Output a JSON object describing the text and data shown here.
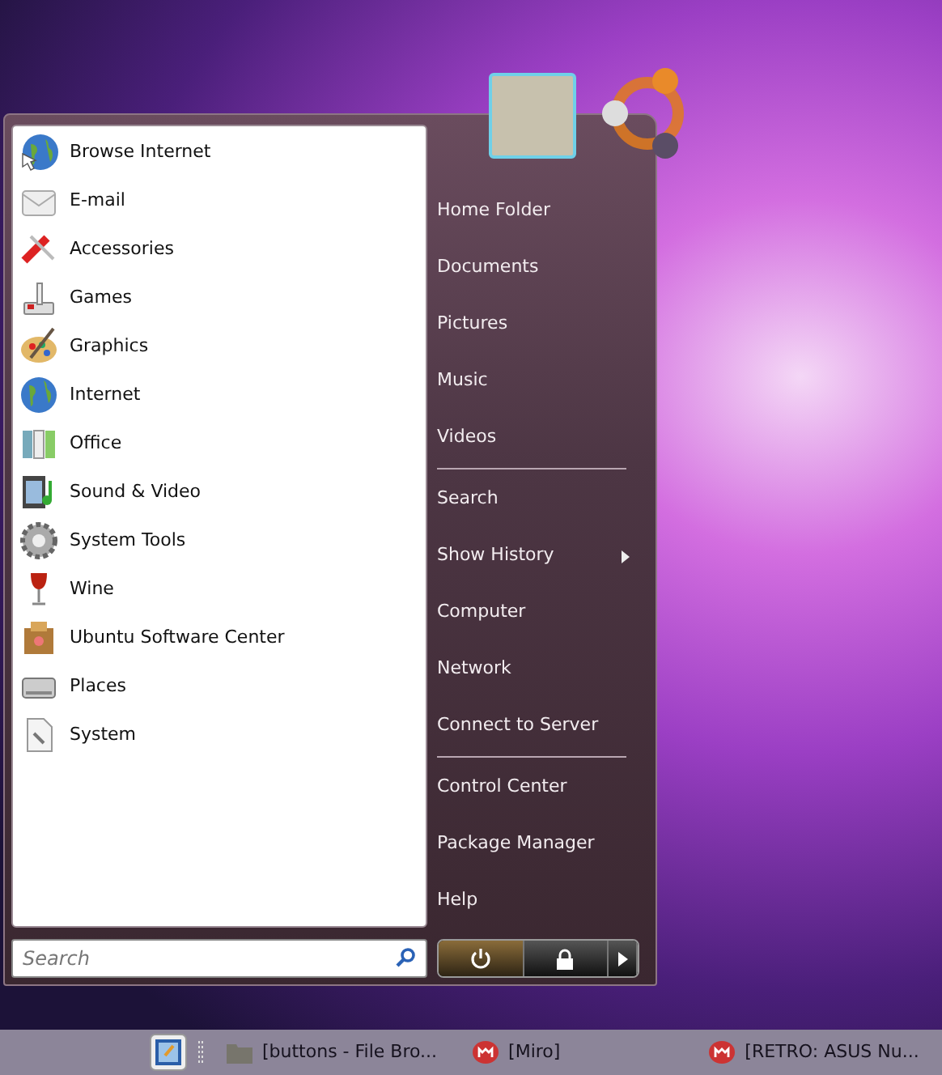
{
  "applications": [
    {
      "label": "Browse Internet",
      "kind": "browser"
    },
    {
      "label": "E-mail",
      "kind": "mail"
    },
    {
      "label": "Accessories",
      "kind": "tools"
    },
    {
      "label": "Games",
      "kind": "games"
    },
    {
      "label": "Graphics",
      "kind": "graphics"
    },
    {
      "label": "Internet",
      "kind": "globe"
    },
    {
      "label": "Office",
      "kind": "office"
    },
    {
      "label": "Sound & Video",
      "kind": "media"
    },
    {
      "label": "System Tools",
      "kind": "gear"
    },
    {
      "label": "Wine",
      "kind": "wine"
    },
    {
      "label": "Ubuntu Software Center",
      "kind": "box"
    },
    {
      "label": "Places",
      "kind": "drive"
    },
    {
      "label": "System",
      "kind": "document"
    }
  ],
  "search": {
    "placeholder": "Search"
  },
  "places": [
    [
      {
        "label": "Home Folder",
        "has_submenu": false
      },
      {
        "label": "Documents",
        "has_submenu": false
      },
      {
        "label": "Pictures",
        "has_submenu": false
      },
      {
        "label": "Music",
        "has_submenu": false
      },
      {
        "label": "Videos",
        "has_submenu": false
      }
    ],
    [
      {
        "label": "Search",
        "has_submenu": false
      },
      {
        "label": "Show History",
        "has_submenu": true
      },
      {
        "label": "Computer",
        "has_submenu": false
      },
      {
        "label": "Network",
        "has_submenu": false
      },
      {
        "label": "Connect to Server",
        "has_submenu": false
      }
    ],
    [
      {
        "label": "Control Center",
        "has_submenu": false
      },
      {
        "label": "Package Manager",
        "has_submenu": false
      },
      {
        "label": "Help",
        "has_submenu": false
      }
    ]
  ],
  "session_buttons": [
    {
      "kind": "power",
      "highlighted": true
    },
    {
      "kind": "lock",
      "highlighted": false
    },
    {
      "kind": "more",
      "highlighted": false
    }
  ],
  "taskbar": [
    {
      "label": "[buttons - File Bro...",
      "kind": "folder"
    },
    {
      "label": "[Miro]",
      "kind": "miro"
    },
    {
      "label": "[RETRO: ASUS Nu...",
      "kind": "miro"
    }
  ]
}
